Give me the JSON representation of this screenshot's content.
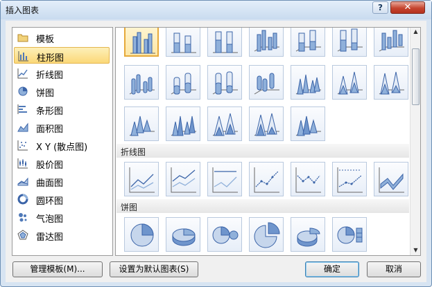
{
  "window": {
    "title": "插入图表",
    "help_label": "?",
    "close_label": "✕"
  },
  "sidebar": {
    "items": [
      {
        "label": "模板",
        "icon": "folder-icon"
      },
      {
        "label": "柱形图",
        "icon": "column-chart-icon",
        "selected": true
      },
      {
        "label": "折线图",
        "icon": "line-chart-icon"
      },
      {
        "label": "饼图",
        "icon": "pie-chart-icon"
      },
      {
        "label": "条形图",
        "icon": "bar-chart-icon"
      },
      {
        "label": "面积图",
        "icon": "area-chart-icon"
      },
      {
        "label": "X Y (散点图)",
        "icon": "scatter-chart-icon"
      },
      {
        "label": "股价图",
        "icon": "stock-chart-icon"
      },
      {
        "label": "曲面图",
        "icon": "surface-chart-icon"
      },
      {
        "label": "圆环图",
        "icon": "doughnut-chart-icon"
      },
      {
        "label": "气泡图",
        "icon": "bubble-chart-icon"
      },
      {
        "label": "雷达图",
        "icon": "radar-chart-icon"
      }
    ]
  },
  "gallery": {
    "sections": [
      {
        "label": "折线图"
      },
      {
        "label": "饼图"
      }
    ]
  },
  "buttons": {
    "manage_templates": "管理模板(M)...",
    "set_default": "设置为默认图表(S)",
    "ok": "确定",
    "cancel": "取消"
  },
  "colors": {
    "accent": "#3b64a8",
    "selection": "#fbd878",
    "title_bar": "#c9dbef"
  }
}
